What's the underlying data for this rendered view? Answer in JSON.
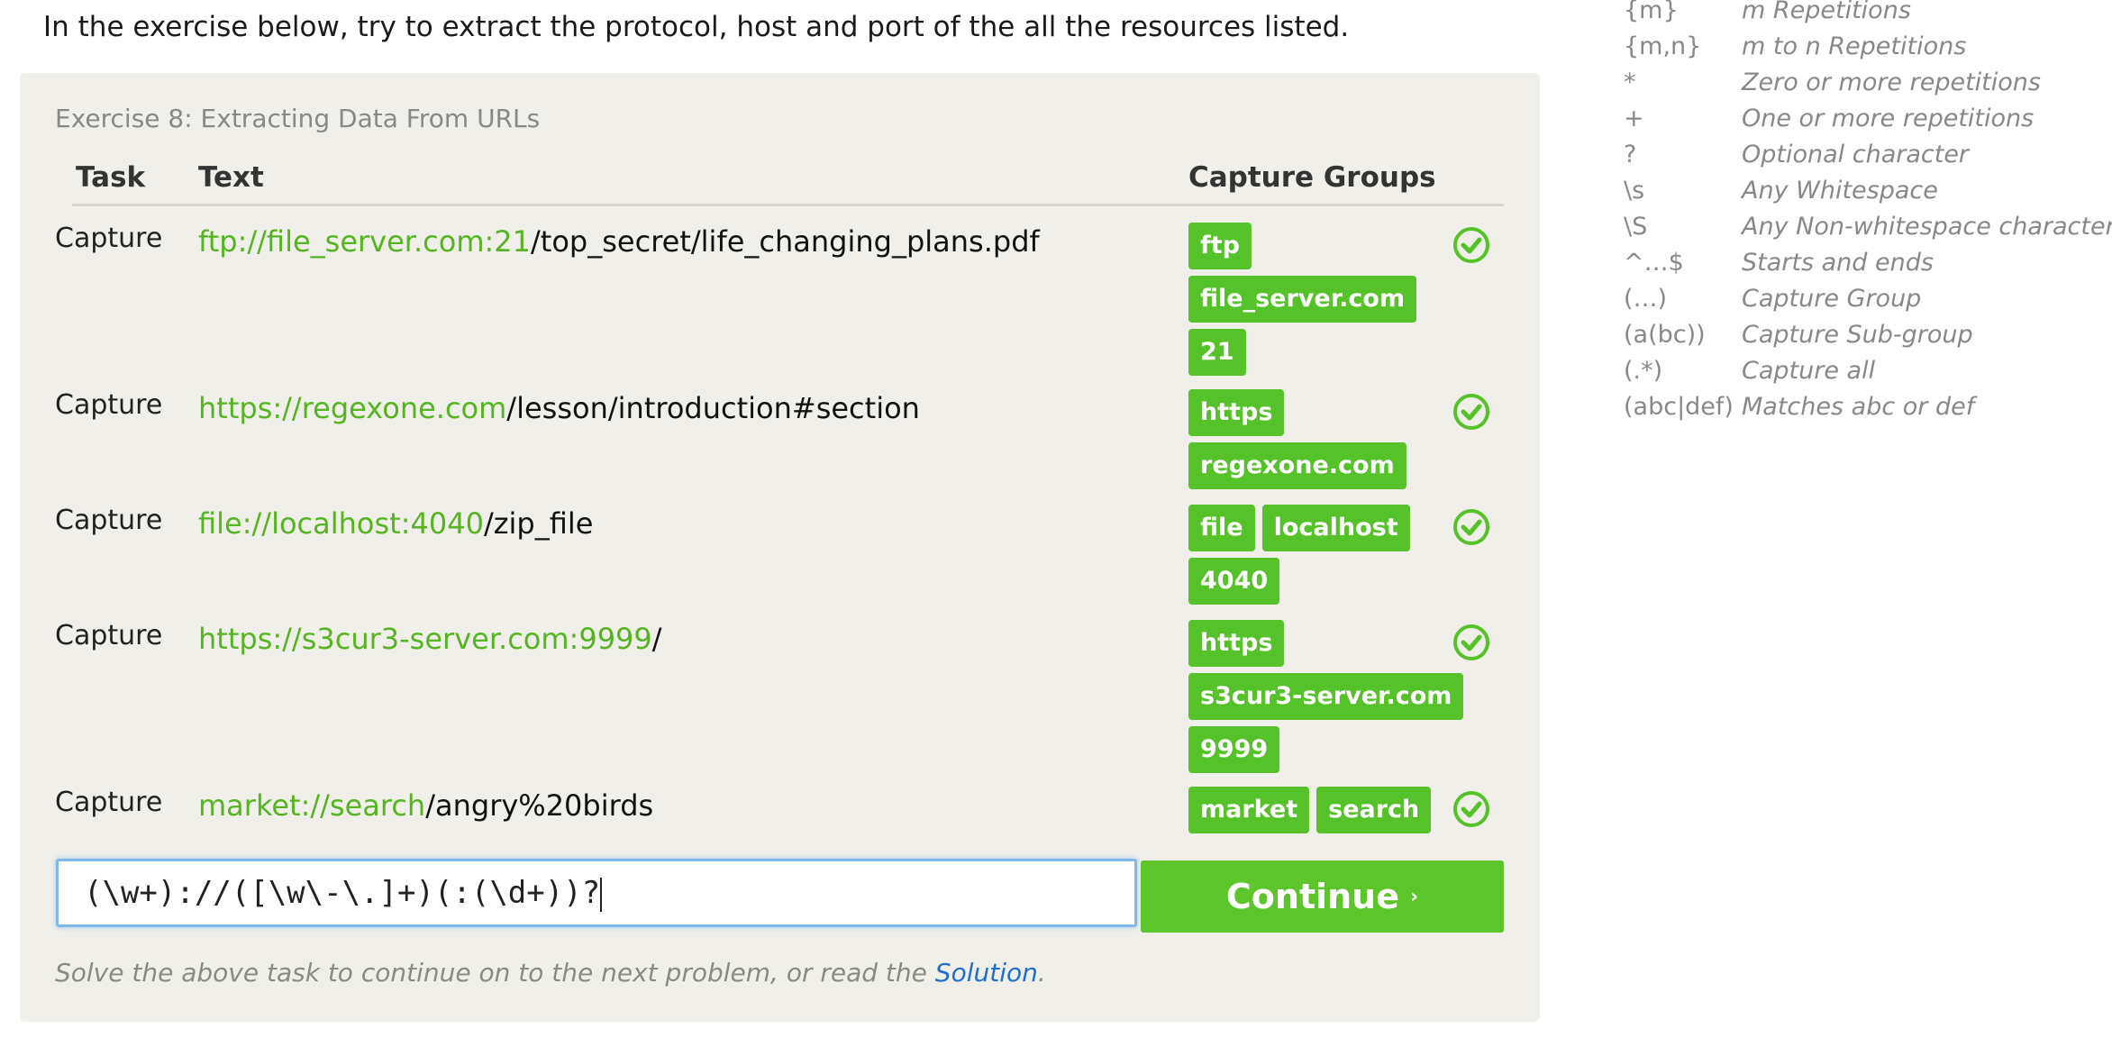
{
  "intro": "In the exercise below, try to extract the protocol, host and port of the all the resources listed.",
  "exercise": {
    "title": "Exercise 8: Extracting Data From URLs",
    "headers": {
      "task": "Task",
      "text": "Text",
      "groups": "Capture Groups"
    },
    "rows": [
      {
        "task": "Capture",
        "match": "ftp://file_server.com:21",
        "rest": "/top_secret/life_changing_plans.pdf",
        "groups": [
          "ftp",
          "file_server.com",
          "21"
        ]
      },
      {
        "task": "Capture",
        "match": "https://regexone.com",
        "rest": "/lesson/introduction#section",
        "groups": [
          "https",
          "regexone.com"
        ]
      },
      {
        "task": "Capture",
        "match": "file://localhost:4040",
        "rest": "/zip_file",
        "groups": [
          "file",
          "localhost",
          "4040"
        ]
      },
      {
        "task": "Capture",
        "match": "https://s3cur3-server.com:9999",
        "rest": "/",
        "groups": [
          "https",
          "s3cur3-server.com",
          "9999"
        ]
      },
      {
        "task": "Capture",
        "match": "market://search",
        "rest": "/angry%20birds",
        "groups": [
          "market",
          "search"
        ]
      }
    ],
    "input_value": "(\\w+)://([\\w\\-\\.]+)(:(\\d+))?",
    "continue_label": "Continue",
    "continue_arrow": "›",
    "footer_text": "Solve the above task to continue on to the next problem, or read the ",
    "footer_link": "Solution",
    "footer_end": "."
  },
  "cheatsheet": [
    {
      "symbol": "{m}",
      "desc": "m Repetitions"
    },
    {
      "symbol": "{m,n}",
      "desc": "m to n Repetitions"
    },
    {
      "symbol": "*",
      "desc": "Zero or more repetitions"
    },
    {
      "symbol": "+",
      "desc": "One or more repetitions"
    },
    {
      "symbol": "?",
      "desc": "Optional character"
    },
    {
      "symbol": "\\s",
      "desc": "Any Whitespace"
    },
    {
      "symbol": "\\S",
      "desc": "Any Non-whitespace character"
    },
    {
      "symbol": "^…$",
      "desc": "Starts and ends"
    },
    {
      "symbol": "(…)",
      "desc": "Capture Group"
    },
    {
      "symbol": "(a(bc))",
      "desc": "Capture Sub-group"
    },
    {
      "symbol": "(.*)",
      "desc": "Capture all"
    },
    {
      "symbol": "(abc|def)",
      "desc": "Matches abc or def"
    }
  ],
  "colors": {
    "match": "#55b521",
    "chip": "#55c22a",
    "button": "#5cc52a",
    "link": "#1f6fd1"
  }
}
